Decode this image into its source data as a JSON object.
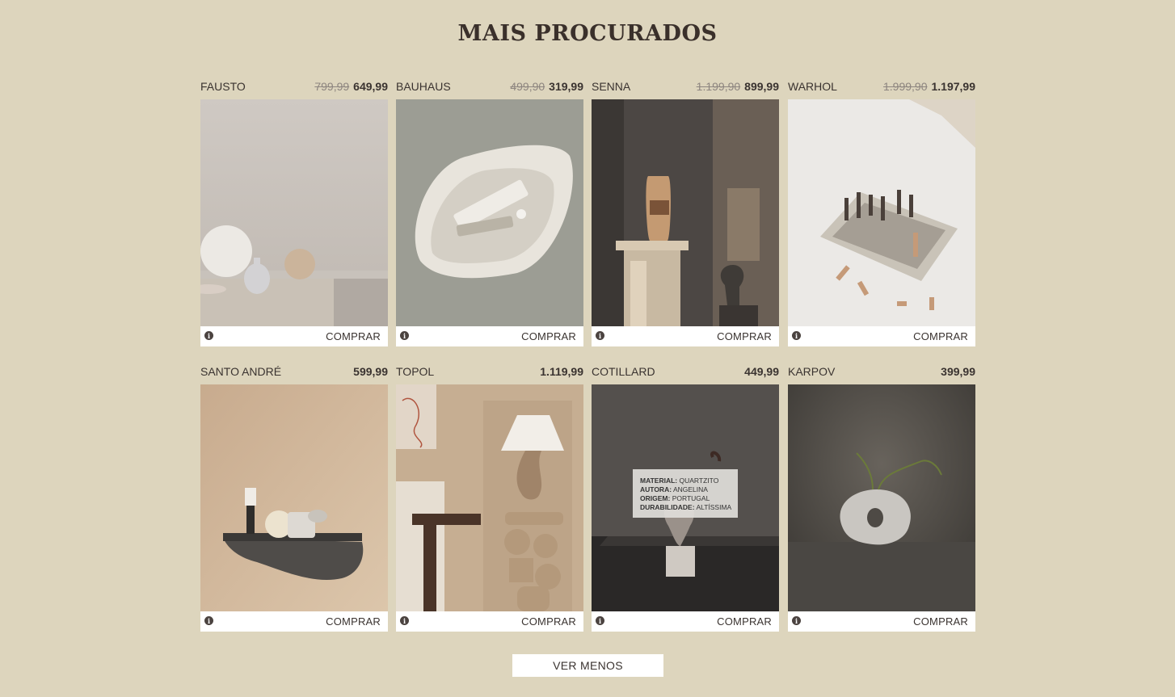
{
  "section": {
    "title": "MAIS PROCURADOS"
  },
  "products": [
    {
      "name": "FAUSTO",
      "old_price": "799,99",
      "price": "649,99",
      "buy": "COMPRAR",
      "image": "ceramic-vases-on-table"
    },
    {
      "name": "BAUHAUS",
      "old_price": "499,90",
      "price": "319,99",
      "buy": "COMPRAR",
      "image": "shell-dish-with-tube"
    },
    {
      "name": "SENNA",
      "old_price": "1.199,90",
      "price": "899,99",
      "buy": "COMPRAR",
      "image": "vase-on-pedestal"
    },
    {
      "name": "WARHOL",
      "old_price": "1.999,90",
      "price": "1.197,99",
      "buy": "COMPRAR",
      "image": "stone-chess-set"
    },
    {
      "name": "SANTO ANDRÉ",
      "old_price": "",
      "price": "599,99",
      "buy": "COMPRAR",
      "image": "wall-shelf-with-cups"
    },
    {
      "name": "TOPOL",
      "old_price": "",
      "price": "1.119,99",
      "buy": "COMPRAR",
      "image": "sculptural-table-lamp"
    },
    {
      "name": "COTILLARD",
      "old_price": "",
      "price": "449,99",
      "buy": "COMPRAR",
      "image": "quartzite-vase",
      "tooltip": {
        "material_label": "MATERIAL:",
        "material": "QUARTZITO",
        "author_label": "AUTORA:",
        "author": "ANGELINA",
        "origin_label": "ORIGEM:",
        "origin": "PORTUGAL",
        "durability_label": "DURABILIDADE:",
        "durability": "ALTÍSSIMA"
      }
    },
    {
      "name": "KARPOV",
      "old_price": "",
      "price": "399,99",
      "buy": "COMPRAR",
      "image": "donut-vase-with-branch"
    }
  ],
  "info_icon": "info-icon",
  "show_less": "VER MENOS",
  "colors": {
    "background": "#ddd5bd",
    "text": "#3a3330",
    "old_price": "#8d857f"
  }
}
